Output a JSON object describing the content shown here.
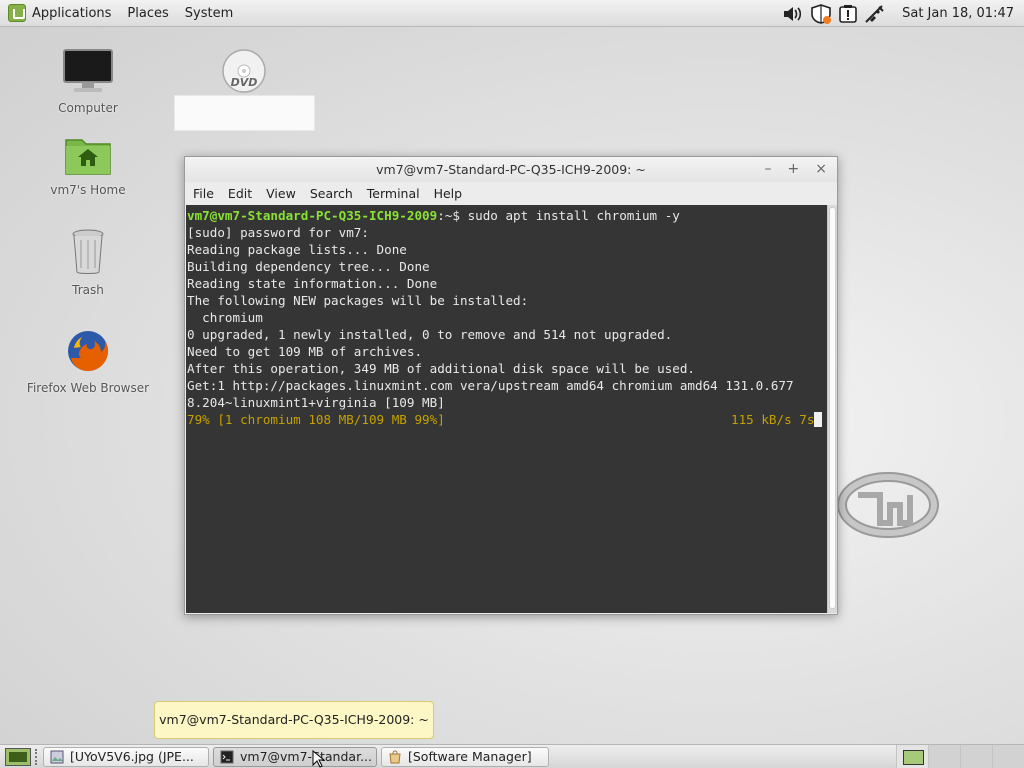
{
  "top_panel": {
    "menu": [
      "Applications",
      "Places",
      "System"
    ],
    "clock": "Sat Jan 18, 01:47",
    "tray_icons": [
      "volume-icon",
      "shield-icon",
      "notification-icon",
      "network-icon"
    ]
  },
  "desktop": {
    "icons": [
      {
        "label": "Computer",
        "icon": "monitor-icon"
      },
      {
        "label": "vm7's Home",
        "icon": "home-folder-icon"
      },
      {
        "label": "Trash",
        "icon": "trash-icon"
      },
      {
        "label": "Firefox Web Browser",
        "icon": "firefox-icon"
      },
      {
        "label": "",
        "icon": "dvd-icon"
      }
    ],
    "dvd_text": "DVD"
  },
  "terminal": {
    "title": "vm7@vm7-Standard-PC-Q35-ICH9-2009: ~",
    "controls": [
      "–",
      "+",
      "×"
    ],
    "menu": [
      "File",
      "Edit",
      "View",
      "Search",
      "Terminal",
      "Help"
    ],
    "prompt_user": "vm7@vm7-Standard-PC-Q35-ICH9-2009",
    "prompt_path": ":~$ ",
    "command": "sudo apt install chromium -y",
    "output_lines": [
      "[sudo] password for vm7:",
      "Reading package lists... Done",
      "Building dependency tree... Done",
      "Reading state information... Done",
      "The following NEW packages will be installed:",
      "  chromium",
      "0 upgraded, 1 newly installed, 0 to remove and 514 not upgraded.",
      "Need to get 109 MB of archives.",
      "After this operation, 349 MB of additional disk space will be used.",
      "Get:1 http://packages.linuxmint.com vera/upstream amd64 chromium amd64 131.0.677",
      "8.204~linuxmint1+virginia [109 MB]"
    ],
    "progress_left": "79% [1 chromium 108 MB/109 MB 99%]",
    "progress_right": "115 kB/s 7s"
  },
  "tooltip": {
    "text": "vm7@vm7-Standard-PC-Q35-ICH9-2009: ~"
  },
  "taskbar": {
    "items": [
      {
        "label": "[UYoV5V6.jpg (JPE...",
        "icon": "image-viewer-icon",
        "active": false
      },
      {
        "label": "vm7@vm7-Standar...",
        "icon": "terminal-icon",
        "active": true
      },
      {
        "label": "[Software Manager]",
        "icon": "software-manager-icon",
        "active": false
      }
    ],
    "workspaces": 4,
    "active_workspace": 1
  },
  "colors": {
    "terminal_bg": "#353535",
    "prompt_green": "#8ae234",
    "progress_yellow": "#c4a000",
    "tooltip_bg": "#fdf6c5"
  }
}
